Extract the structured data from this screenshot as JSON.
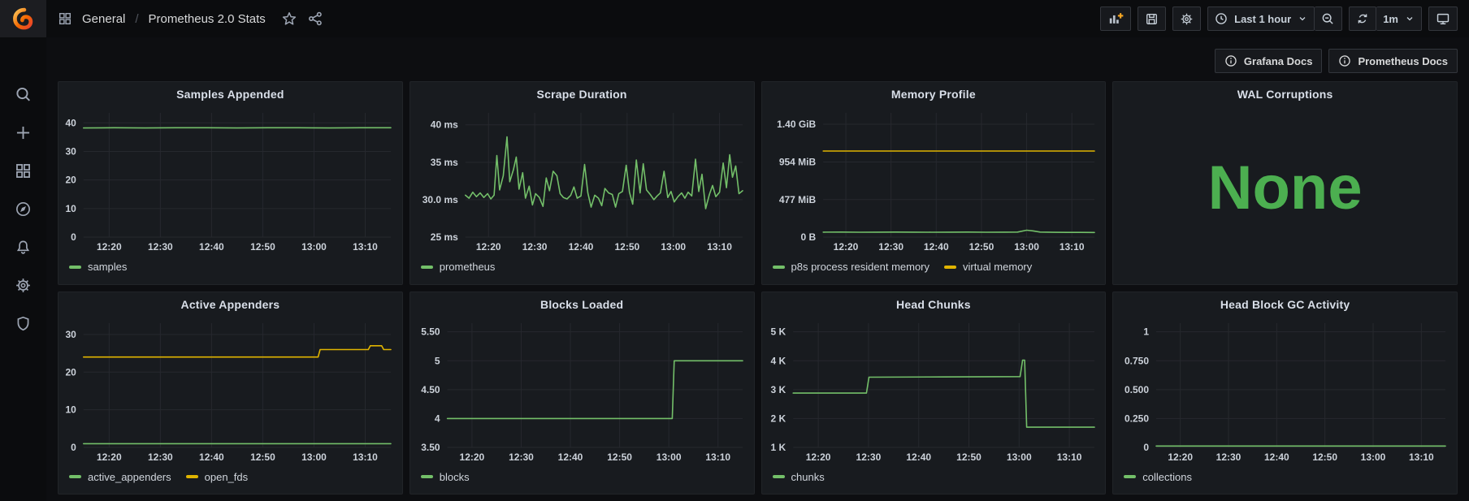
{
  "header": {
    "breadcrumb": {
      "section": "General",
      "separator": "/",
      "title": "Prometheus 2.0 Stats"
    },
    "toolbar": {
      "time_range": "Last 1 hour",
      "refresh_interval": "1m"
    }
  },
  "doc_links": [
    {
      "label": "Grafana Docs"
    },
    {
      "label": "Prometheus Docs"
    }
  ],
  "icons": {
    "sidebar": [
      "search-icon",
      "plus-icon",
      "dashboards-icon",
      "explore-compass-icon",
      "alerting-bell-icon",
      "settings-gear-icon",
      "server-admin-shield-icon"
    ],
    "breadcrumb": [
      "apps-grid-icon",
      "star-icon",
      "share-icon"
    ],
    "toolbar": [
      "add-panel-icon",
      "save-icon",
      "gear-icon",
      "clock-icon",
      "chevron-down-icon",
      "zoom-out-icon",
      "refresh-icon",
      "tv-icon"
    ],
    "docs": [
      "info-circle-icon"
    ]
  },
  "colors": {
    "green": "#73bf69",
    "yellow": "#e0b400",
    "stat_green": "#4caf50",
    "panel_bg": "#181b1f",
    "page_bg": "#0d0e11",
    "grid_line": "#26282e"
  },
  "chart_data": [
    {
      "type": "line",
      "title": "Samples Appended",
      "xlim": [
        0,
        60
      ],
      "ylim": [
        0,
        43.5
      ],
      "x_ticks": {
        "positions": [
          5,
          15,
          25,
          35,
          45,
          55
        ],
        "labels": [
          "12:20",
          "12:30",
          "12:40",
          "12:50",
          "13:00",
          "13:10"
        ]
      },
      "y_ticks": [
        {
          "label": "0",
          "value": 0
        },
        {
          "label": "10",
          "value": 10
        },
        {
          "label": "20",
          "value": 20
        },
        {
          "label": "30",
          "value": 30
        },
        {
          "label": "40",
          "value": 40
        }
      ],
      "series": [
        {
          "name": "samples",
          "color": "#73bf69",
          "points": [
            [
              0,
              38.2
            ],
            [
              6,
              38.3
            ],
            [
              12,
              38.2
            ],
            [
              18,
              38.3
            ],
            [
              24,
              38.3
            ],
            [
              30,
              38.2
            ],
            [
              36,
              38.3
            ],
            [
              42,
              38.3
            ],
            [
              48,
              38.2
            ],
            [
              54,
              38.3
            ],
            [
              60,
              38.3
            ]
          ]
        }
      ]
    },
    {
      "type": "line",
      "title": "Scrape Duration",
      "xlim": [
        0,
        60
      ],
      "ylim": [
        25,
        41.6
      ],
      "x_ticks": {
        "positions": [
          5,
          15,
          25,
          35,
          45,
          55
        ],
        "labels": [
          "12:20",
          "12:30",
          "12:40",
          "12:50",
          "13:00",
          "13:10"
        ]
      },
      "y_ticks": [
        {
          "label": "25 ms",
          "value": 25
        },
        {
          "label": "30.0 ms",
          "value": 30
        },
        {
          "label": "35 ms",
          "value": 35
        },
        {
          "label": "40 ms",
          "value": 40
        }
      ],
      "series": [
        {
          "name": "prometheus",
          "color": "#73bf69",
          "points": [
            [
              0,
              30.6
            ],
            [
              0.8,
              30.2
            ],
            [
              1.6,
              31.0
            ],
            [
              2.4,
              30.4
            ],
            [
              3.2,
              30.9
            ],
            [
              4,
              30.3
            ],
            [
              4.8,
              30.8
            ],
            [
              5.5,
              30.1
            ],
            [
              6.2,
              30.6
            ],
            [
              6.8,
              35.9
            ],
            [
              7.4,
              31.3
            ],
            [
              8.2,
              33.2
            ],
            [
              9,
              38.4
            ],
            [
              9.6,
              32.4
            ],
            [
              10.4,
              34.0
            ],
            [
              11,
              35.7
            ],
            [
              11.6,
              31.4
            ],
            [
              12.4,
              33.6
            ],
            [
              13,
              30.2
            ],
            [
              13.8,
              31.8
            ],
            [
              14.5,
              29.3
            ],
            [
              15.2,
              30.8
            ],
            [
              16,
              30.3
            ],
            [
              16.8,
              29.1
            ],
            [
              17.5,
              32.9
            ],
            [
              18.2,
              31.2
            ],
            [
              19,
              33.8
            ],
            [
              19.8,
              33.2
            ],
            [
              20.5,
              30.8
            ],
            [
              21.2,
              30.3
            ],
            [
              22,
              30.1
            ],
            [
              22.8,
              30.6
            ],
            [
              23.5,
              31.7
            ],
            [
              24.2,
              30.2
            ],
            [
              25,
              30.5
            ],
            [
              25.8,
              34.7
            ],
            [
              26.5,
              30.9
            ],
            [
              27.2,
              29.0
            ],
            [
              28,
              30.6
            ],
            [
              28.8,
              30.2
            ],
            [
              29.5,
              29.2
            ],
            [
              30.2,
              31.5
            ],
            [
              31,
              30.9
            ],
            [
              31.8,
              30.7
            ],
            [
              32.5,
              29.0
            ],
            [
              33.2,
              30.8
            ],
            [
              34,
              31.1
            ],
            [
              34.8,
              34.6
            ],
            [
              35.5,
              31.0
            ],
            [
              36.2,
              29.4
            ],
            [
              37,
              35.3
            ],
            [
              37.8,
              30.9
            ],
            [
              38.5,
              34.8
            ],
            [
              39.2,
              31.3
            ],
            [
              40,
              30.7
            ],
            [
              40.8,
              30.0
            ],
            [
              41.5,
              30.5
            ],
            [
              42.2,
              30.9
            ],
            [
              43,
              33.8
            ],
            [
              43.8,
              30.3
            ],
            [
              44.5,
              31.1
            ],
            [
              45.2,
              29.7
            ],
            [
              46,
              30.4
            ],
            [
              46.8,
              30.9
            ],
            [
              47.5,
              30.2
            ],
            [
              48.2,
              31.0
            ],
            [
              49,
              30.5
            ],
            [
              49.8,
              35.4
            ],
            [
              50.5,
              31.1
            ],
            [
              51.2,
              33.4
            ],
            [
              52,
              28.8
            ],
            [
              52.8,
              30.7
            ],
            [
              53.5,
              31.9
            ],
            [
              54.2,
              30.4
            ],
            [
              55,
              31.0
            ],
            [
              55.8,
              34.9
            ],
            [
              56.5,
              31.6
            ],
            [
              57.2,
              36.0
            ],
            [
              57.8,
              33.0
            ],
            [
              58.5,
              34.5
            ],
            [
              59.2,
              30.8
            ],
            [
              60,
              31.2
            ]
          ]
        }
      ]
    },
    {
      "type": "line",
      "title": "Memory Profile",
      "xlim": [
        0,
        60
      ],
      "ylim": [
        0,
        1578
      ],
      "x_ticks": {
        "positions": [
          5,
          15,
          25,
          35,
          45,
          55
        ],
        "labels": [
          "12:20",
          "12:30",
          "12:40",
          "12:50",
          "13:00",
          "13:10"
        ]
      },
      "y_ticks": [
        {
          "label": "0 B",
          "value": 0
        },
        {
          "label": "477 MiB",
          "value": 477
        },
        {
          "label": "954 MiB",
          "value": 954
        },
        {
          "label": "1.40 GiB",
          "value": 1434
        }
      ],
      "series": [
        {
          "name": "p8s process resident memory",
          "color": "#73bf69",
          "points": [
            [
              0,
              63
            ],
            [
              4,
              64
            ],
            [
              8,
              62
            ],
            [
              12,
              63
            ],
            [
              16,
              64
            ],
            [
              20,
              63
            ],
            [
              24,
              62
            ],
            [
              28,
              63
            ],
            [
              32,
              64
            ],
            [
              36,
              62
            ],
            [
              40,
              63
            ],
            [
              43,
              64
            ],
            [
              45,
              88
            ],
            [
              46.5,
              78
            ],
            [
              48,
              64
            ],
            [
              51,
              61
            ],
            [
              54,
              60
            ],
            [
              57,
              60
            ],
            [
              60,
              59
            ]
          ]
        },
        {
          "name": "virtual memory",
          "color": "#e0b400",
          "points": [
            [
              0,
              1093
            ],
            [
              60,
              1093
            ]
          ]
        }
      ]
    },
    {
      "type": "stat",
      "title": "WAL Corruptions",
      "value": "None",
      "value_color": "#4caf50"
    },
    {
      "type": "line",
      "title": "Active Appenders",
      "xlim": [
        0,
        60
      ],
      "ylim": [
        0,
        33
      ],
      "x_ticks": {
        "positions": [
          5,
          15,
          25,
          35,
          45,
          55
        ],
        "labels": [
          "12:20",
          "12:30",
          "12:40",
          "12:50",
          "13:00",
          "13:10"
        ]
      },
      "y_ticks": [
        {
          "label": "0",
          "value": 0
        },
        {
          "label": "10",
          "value": 10
        },
        {
          "label": "20",
          "value": 20
        },
        {
          "label": "30",
          "value": 30
        }
      ],
      "series": [
        {
          "name": "active_appenders",
          "color": "#73bf69",
          "points": [
            [
              0,
              1
            ],
            [
              60,
              1
            ]
          ]
        },
        {
          "name": "open_fds",
          "color": "#e0b400",
          "points": [
            [
              0,
              24
            ],
            [
              45.8,
              24
            ],
            [
              46.2,
              26
            ],
            [
              55.6,
              26
            ],
            [
              56,
              27
            ],
            [
              58.2,
              27
            ],
            [
              58.6,
              26
            ],
            [
              60,
              26
            ]
          ]
        }
      ]
    },
    {
      "type": "line",
      "title": "Blocks Loaded",
      "xlim": [
        0,
        60
      ],
      "ylim": [
        3.5,
        5.65
      ],
      "x_ticks": {
        "positions": [
          5,
          15,
          25,
          35,
          45,
          55
        ],
        "labels": [
          "12:20",
          "12:30",
          "12:40",
          "12:50",
          "13:00",
          "13:10"
        ]
      },
      "y_ticks": [
        {
          "label": "3.50",
          "value": 3.5
        },
        {
          "label": "4",
          "value": 4
        },
        {
          "label": "4.50",
          "value": 4.5
        },
        {
          "label": "5",
          "value": 5
        },
        {
          "label": "5.50",
          "value": 5.5
        }
      ],
      "series": [
        {
          "name": "blocks",
          "color": "#73bf69",
          "points": [
            [
              0,
              4
            ],
            [
              45.7,
              4
            ],
            [
              46.1,
              5
            ],
            [
              60,
              5
            ]
          ]
        }
      ]
    },
    {
      "type": "line",
      "title": "Head Chunks",
      "xlim": [
        0,
        60
      ],
      "ylim": [
        1000,
        5300
      ],
      "x_ticks": {
        "positions": [
          5,
          15,
          25,
          35,
          45,
          55
        ],
        "labels": [
          "12:20",
          "12:30",
          "12:40",
          "12:50",
          "13:00",
          "13:10"
        ]
      },
      "y_ticks": [
        {
          "label": "1 K",
          "value": 1000
        },
        {
          "label": "2 K",
          "value": 2000
        },
        {
          "label": "3 K",
          "value": 3000
        },
        {
          "label": "4 K",
          "value": 4000
        },
        {
          "label": "5 K",
          "value": 5000
        }
      ],
      "series": [
        {
          "name": "chunks",
          "color": "#73bf69",
          "points": [
            [
              0,
              2880
            ],
            [
              14.6,
              2880
            ],
            [
              15.1,
              3430
            ],
            [
              30,
              3440
            ],
            [
              45.2,
              3450
            ],
            [
              45.7,
              4020
            ],
            [
              46.1,
              4020
            ],
            [
              46.5,
              1700
            ],
            [
              60,
              1700
            ]
          ]
        }
      ]
    },
    {
      "type": "line",
      "title": "Head Block GC Activity",
      "xlim": [
        0,
        60
      ],
      "ylim": [
        0,
        1.075
      ],
      "x_ticks": {
        "positions": [
          5,
          15,
          25,
          35,
          45,
          55
        ],
        "labels": [
          "12:20",
          "12:30",
          "12:40",
          "12:50",
          "13:00",
          "13:10"
        ]
      },
      "y_ticks": [
        {
          "label": "0",
          "value": 0
        },
        {
          "label": "0.250",
          "value": 0.25
        },
        {
          "label": "0.500",
          "value": 0.5
        },
        {
          "label": "0.750",
          "value": 0.75
        },
        {
          "label": "1",
          "value": 1
        }
      ],
      "series": [
        {
          "name": "collections",
          "color": "#73bf69",
          "points": [
            [
              0,
              0.012
            ],
            [
              60,
              0.012
            ]
          ]
        }
      ]
    }
  ]
}
